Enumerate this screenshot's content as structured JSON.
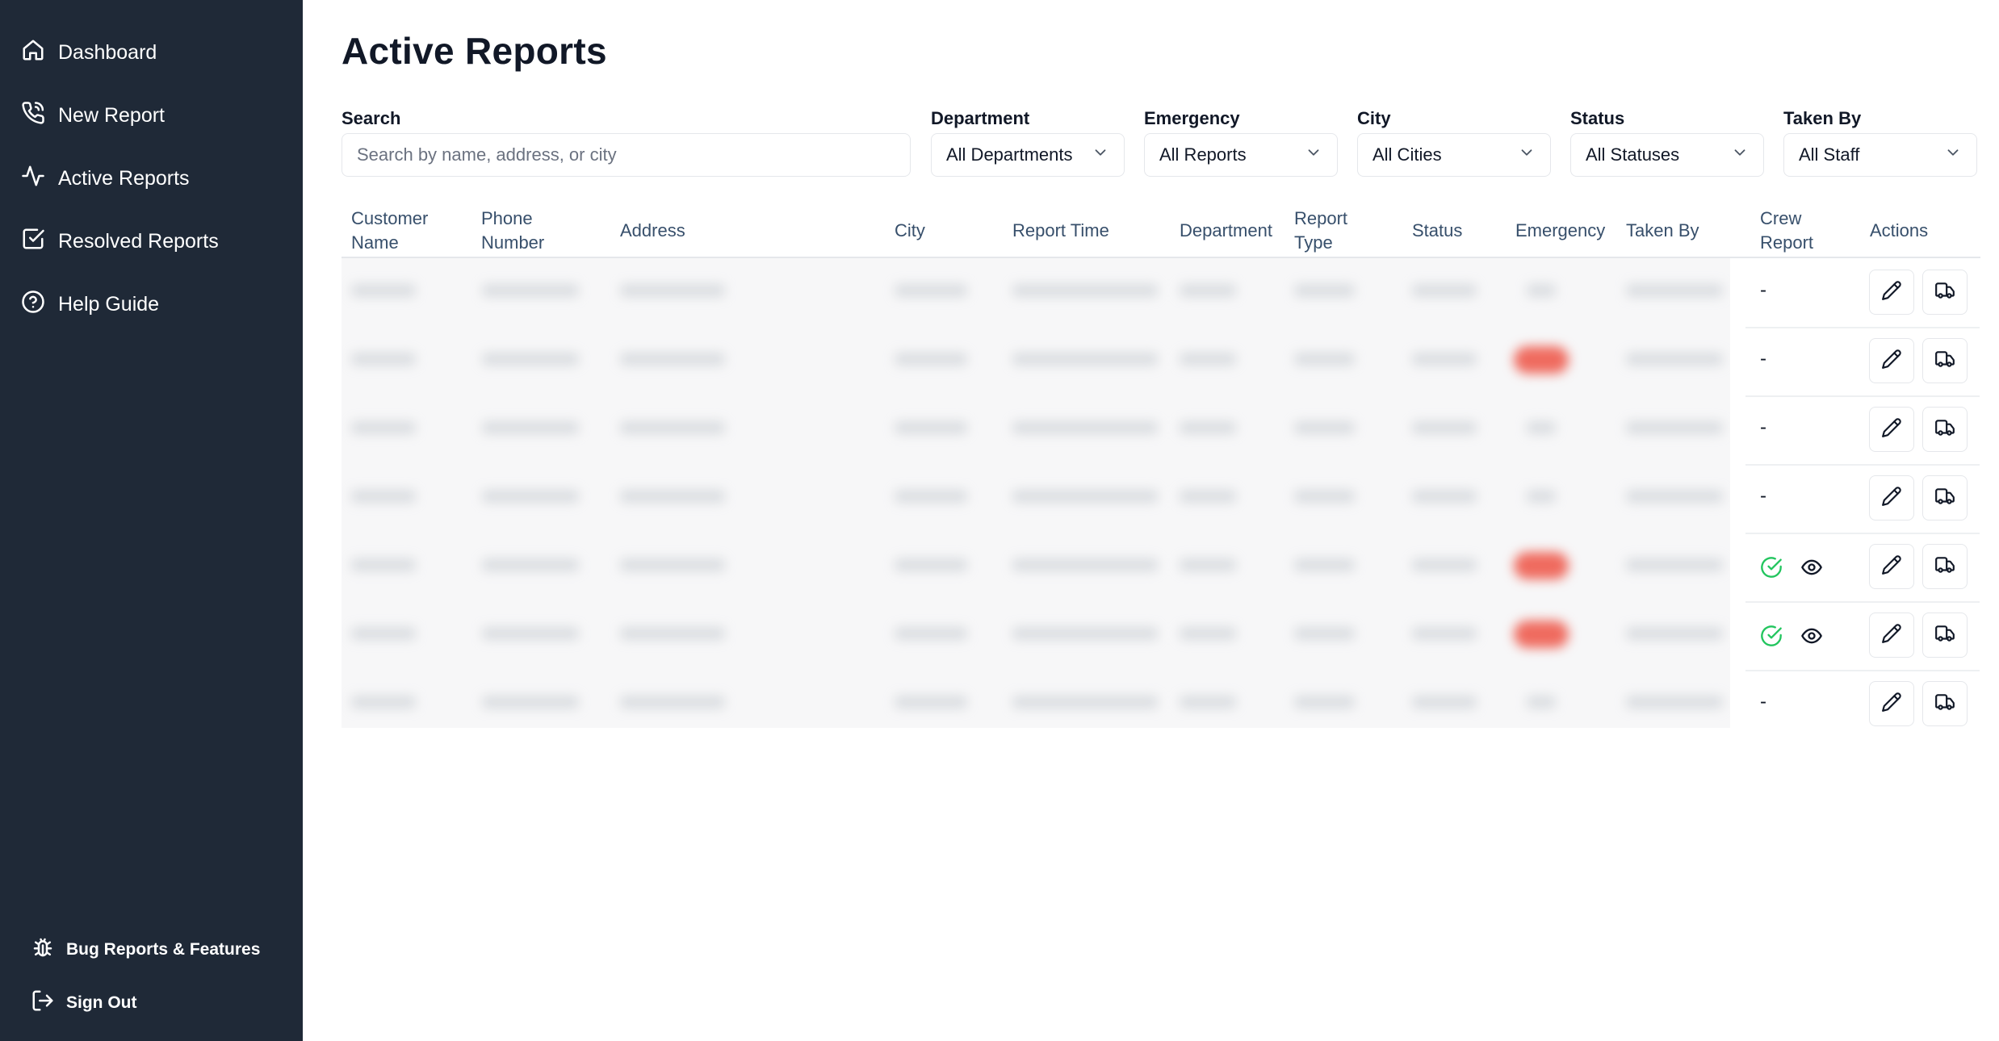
{
  "sidebar": {
    "nav": [
      {
        "label": "Dashboard",
        "icon": "home-icon"
      },
      {
        "label": "New Report",
        "icon": "phone-icon"
      },
      {
        "label": "Active Reports",
        "icon": "activity-icon"
      },
      {
        "label": "Resolved Reports",
        "icon": "check-square-icon"
      },
      {
        "label": "Help Guide",
        "icon": "help-circle-icon"
      }
    ],
    "footer": {
      "bug_label": "Bug Reports & Features",
      "signout_label": "Sign Out"
    }
  },
  "page": {
    "title": "Active Reports"
  },
  "filters": {
    "search": {
      "label": "Search",
      "placeholder": "Search by name, address, or city"
    },
    "department": {
      "label": "Department",
      "value": "All Departments"
    },
    "emergency": {
      "label": "Emergency",
      "value": "All Reports"
    },
    "city": {
      "label": "City",
      "value": "All Cities"
    },
    "status": {
      "label": "Status",
      "value": "All Statuses"
    },
    "taken_by": {
      "label": "Taken By",
      "value": "All Staff"
    }
  },
  "table": {
    "columns": {
      "customer_name_1": "Customer",
      "customer_name_2": "Name",
      "phone_1": "Phone",
      "phone_2": "Number",
      "address": "Address",
      "city": "City",
      "report_time": "Report Time",
      "department": "Department",
      "report_type_1": "Report",
      "report_type_2": "Type",
      "status": "Status",
      "emergency": "Emergency",
      "taken_by": "Taken By",
      "crew_report_1": "Crew",
      "crew_report_2": "Report",
      "actions": "Actions"
    },
    "rows": [
      {
        "crew_report": "-",
        "emergency": false
      },
      {
        "crew_report": "-",
        "emergency": true
      },
      {
        "crew_report": "-",
        "emergency": false
      },
      {
        "crew_report": "-",
        "emergency": false
      },
      {
        "crew_report": "check+view",
        "emergency": true
      },
      {
        "crew_report": "check+view",
        "emergency": true
      },
      {
        "crew_report": "-",
        "emergency": false
      }
    ]
  },
  "colors": {
    "sidebar_bg": "#1f2937",
    "emergency_pill": "#ef6b5f",
    "crew_check": "#22c55e"
  }
}
